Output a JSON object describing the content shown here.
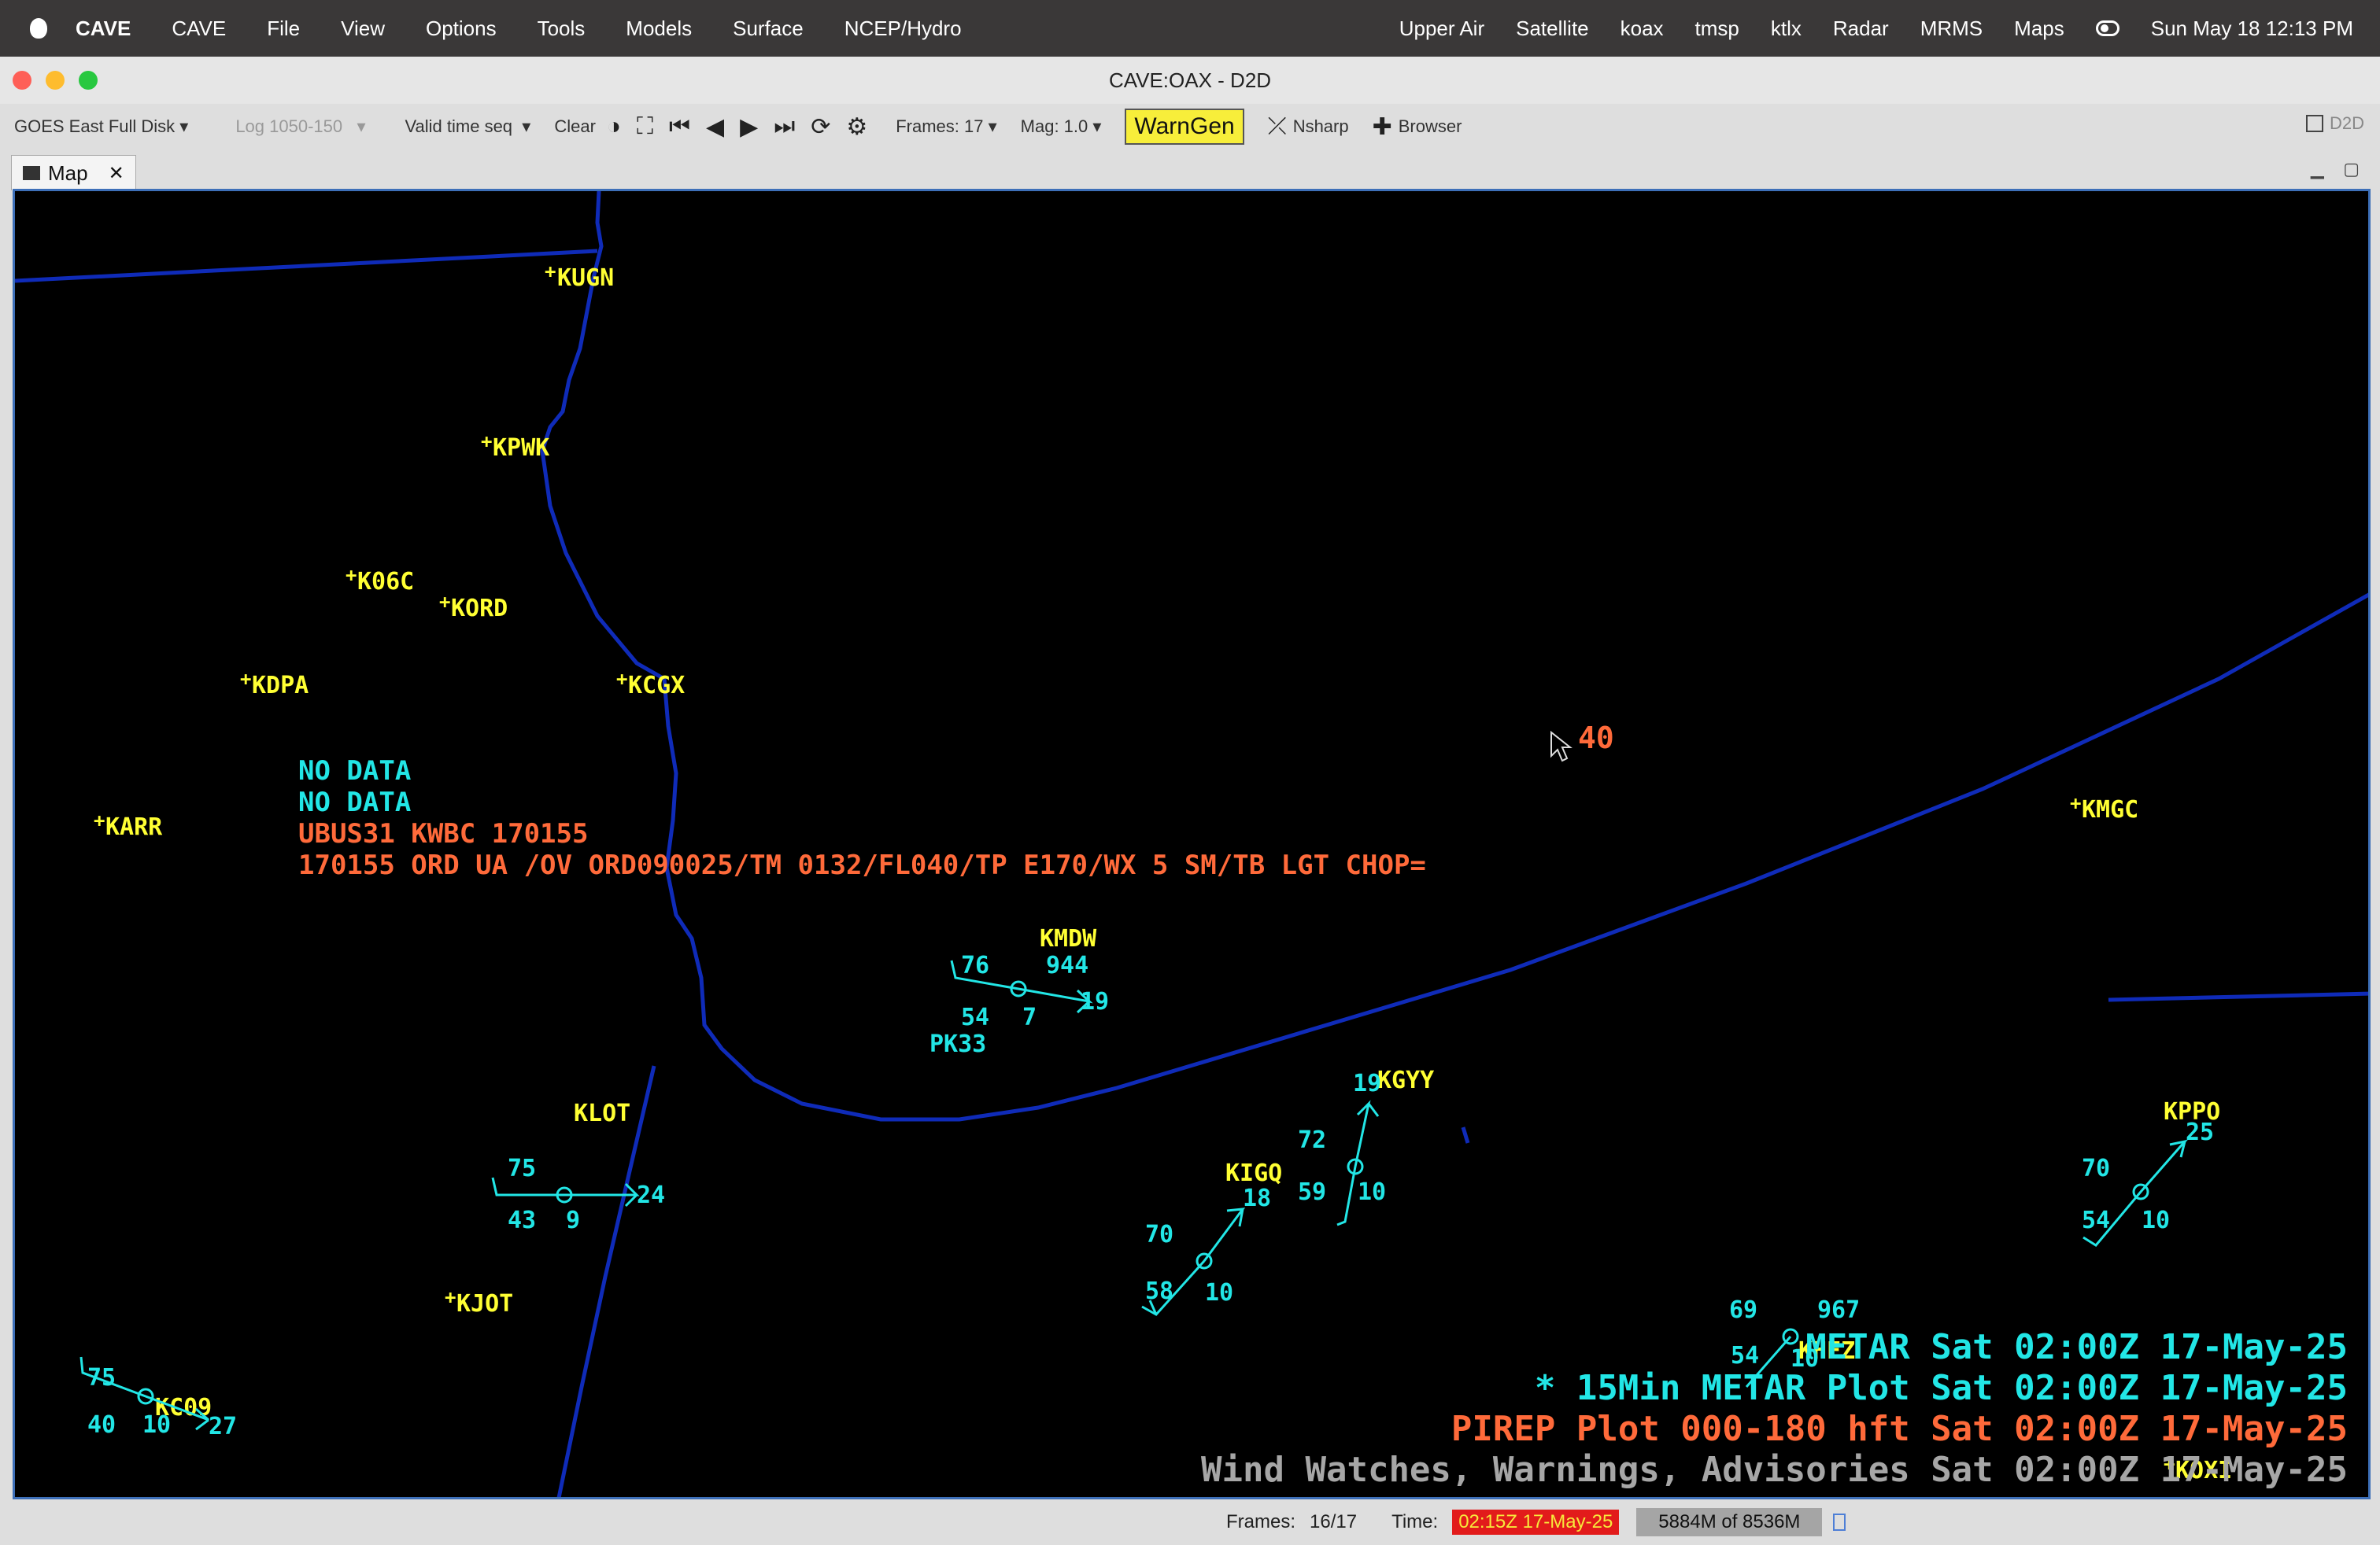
{
  "menubar": {
    "app": "CAVE",
    "items": [
      "CAVE",
      "File",
      "View",
      "Options",
      "Tools",
      "Models",
      "Surface",
      "NCEP/Hydro"
    ],
    "right_items": [
      "Upper Air",
      "Satellite",
      "koax",
      "tmsp",
      "ktlx",
      "Radar",
      "MRMS",
      "Maps"
    ],
    "datetime": "Sun May 18  12:13 PM"
  },
  "window": {
    "title": "CAVE:OAX - D2D"
  },
  "toolbar": {
    "goes": "GOES East Full Disk",
    "log": "Log 1050-150",
    "valid": "Valid time seq",
    "clear": "Clear",
    "frames": "Frames: 17",
    "mag": "Mag: 1.0",
    "warngen": "WarnGen",
    "nsharp": "Nsharp",
    "browser": "Browser",
    "d2d": "D2D"
  },
  "tab": {
    "label": "Map"
  },
  "map": {
    "stations": [
      "KUGN",
      "KPWK",
      "K06C",
      "KORD",
      "KDPA",
      "KCGX",
      "KARR",
      "KMDW",
      "KMGC",
      "KGYY",
      "KLOT",
      "KIGQ",
      "KPPO",
      "KJOT",
      "KC09",
      "KHEZ",
      "KOXI"
    ],
    "obs": {
      "kmdw": [
        "76",
        "944",
        "54",
        "7",
        "19",
        "PK33"
      ],
      "klot": [
        "75",
        "43",
        "9",
        "24"
      ],
      "kgyy": [
        "19",
        "72",
        "59",
        "10"
      ],
      "kigq": [
        "18",
        "70",
        "58",
        "10"
      ],
      "kppo": [
        "25",
        "70",
        "54",
        "10"
      ],
      "kc09": [
        "75",
        "40",
        "10",
        "27"
      ],
      "khez": [
        "69",
        "967",
        "54",
        "10"
      ]
    },
    "cursor_value": "40",
    "pirep": {
      "nodata1": "NO DATA",
      "nodata2": "NO DATA",
      "header": "UBUS31 KWBC 170155",
      "report": "170155 ORD UA /OV ORD090025/TM 0132/FL040/TP E170/WX 5 SM/TB LGT CHOP="
    },
    "legend": [
      "METAR Sat 02:00Z 17-May-25",
      "* 15Min METAR Plot  Sat 02:00Z 17-May-25",
      "PIREP Plot 000-180 hft Sat 02:00Z 17-May-25",
      "Wind Watches, Warnings, Advisories Sat 02:00Z 17-May-25"
    ],
    "colors": {
      "boundary": "#0f2bb8",
      "station": "#ffff33",
      "obs": "#22e6e6",
      "pirep": "#ff6a3a",
      "legend_wind": "#a6a6a6"
    }
  },
  "status": {
    "frames_label": "Frames:",
    "frames_value": "16/17",
    "time_label": "Time:",
    "time_value": "02:15Z 17-May-25",
    "memory": "5884M of 8536M"
  }
}
